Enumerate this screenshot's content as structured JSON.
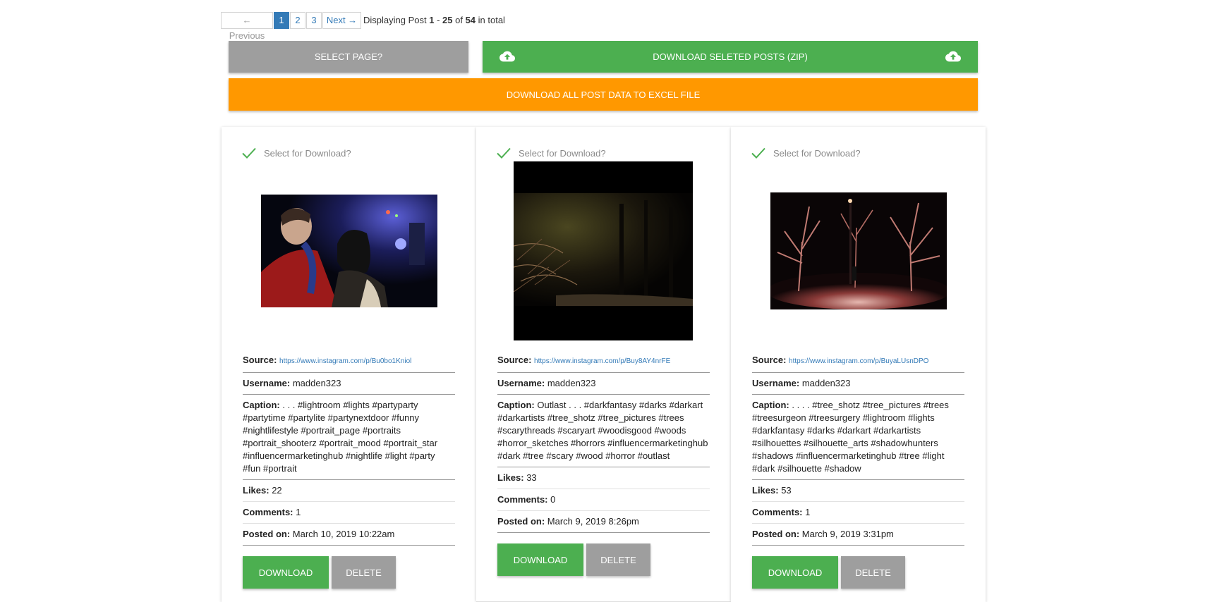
{
  "pagination": {
    "prev_label": "← Previous",
    "pages": [
      "1",
      "2",
      "3"
    ],
    "active_page": "1",
    "next_label": "Next →",
    "info_prefix": "Displaying Post ",
    "range_start": "1",
    "range_sep": " - ",
    "range_end": "25",
    "of_label": " of ",
    "total": "54",
    "suffix": " in total"
  },
  "actions": {
    "select_page_label": "SELECT PAGE?",
    "download_zip_label": "DOWNLOAD SELETED POSTS (ZIP)",
    "excel_label": "DOWNLOAD ALL POST DATA TO EXCEL FILE"
  },
  "labels": {
    "select_for_download": "Select for Download?",
    "source": "Source:",
    "username": "Username:",
    "caption": "Caption:",
    "likes": "Likes:",
    "comments": "Comments:",
    "posted_on": "Posted on:",
    "download": "DOWNLOAD",
    "delete": "DELETE"
  },
  "posts": [
    {
      "source": "https://www.instagram.com/p/Bu0bo1Kniol",
      "username": "madden323",
      "caption": ". . . #lightroom #lights #partyparty #partytime #partylite #partynextdoor #funny #nightlifestyle #portrait_page #portraits #portrait_shooterz #portrait_mood #portrait_star #influencermarketinghub #nightlife #light #party #fun #portrait",
      "likes": "22",
      "comments": "1",
      "posted_on": "March 10, 2019 10:22am"
    },
    {
      "source": "https://www.instagram.com/p/Buy8AY4nrFE",
      "username": "madden323",
      "caption": "Outlast . . . #darkfantasy #darks #darkart #darkartists #tree_shotz #tree_pictures #trees #scarythreads #scaryart #woodisgood #woods #horror_sketches #horrors #influencermarketinghub #dark #tree #scary #wood #horror #outlast",
      "likes": "33",
      "comments": "0",
      "posted_on": "March 9, 2019 8:26pm"
    },
    {
      "source": "https://www.instagram.com/p/BuyaLUsnDPO",
      "username": "madden323",
      "caption": ". . . . #tree_shotz #tree_pictures #trees #treesurgeon #treesurgery #lightroom #lights #darkfantasy #darks #darkart #darkartists #silhouettes #silhouette_arts #shadowhunters #shadows #influencermarketinghub #tree #light #dark #silhouette #shadow",
      "likes": "53",
      "comments": "1",
      "posted_on": "March 9, 2019 3:31pm"
    }
  ],
  "colors": {
    "green": "#4caf50",
    "grey": "#9e9e9e",
    "orange": "#ff9800",
    "link": "#337ab7"
  },
  "icons": {
    "upload": "cloud-upload-icon",
    "check": "checkmark-icon"
  }
}
